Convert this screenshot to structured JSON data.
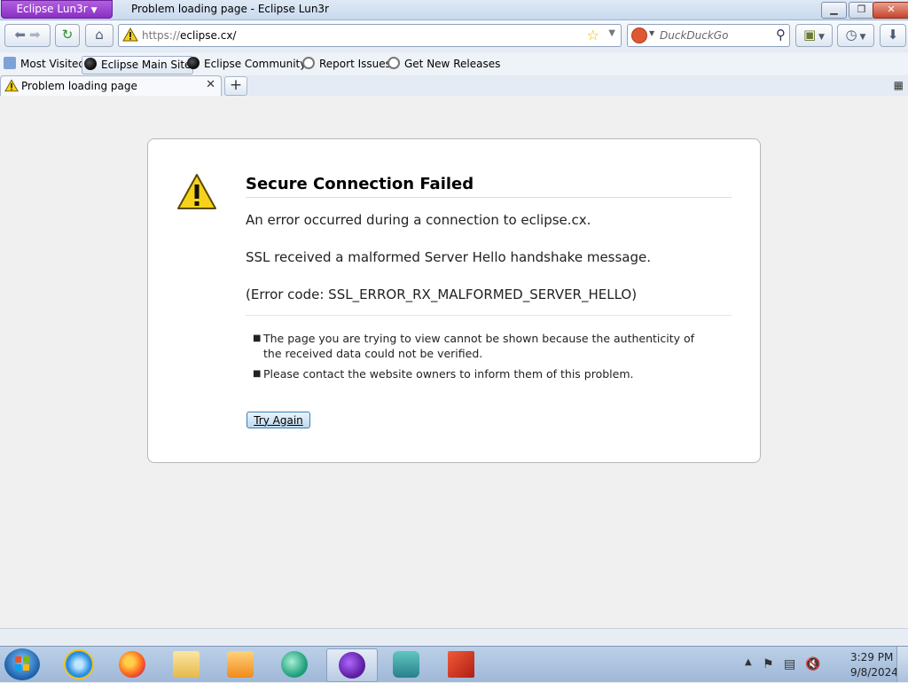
{
  "window": {
    "app_menu_label": "Eclipse Lun3r",
    "title": "Problem loading page - Eclipse Lun3r"
  },
  "navbar": {
    "url_protocol": "https://",
    "url_host": "eclipse.cx/",
    "search_placeholder": "DuckDuckGo"
  },
  "bookmarks": [
    {
      "label": "Most Visited"
    },
    {
      "label": "Eclipse Main Site"
    },
    {
      "label": "Eclipse Community"
    },
    {
      "label": "Report Issues"
    },
    {
      "label": "Get New Releases"
    }
  ],
  "tabs": [
    {
      "label": "Problem loading page"
    }
  ],
  "error": {
    "title": "Secure Connection Failed",
    "line1": "An error occurred during a connection to eclipse.cx.",
    "line2": "SSL received a malformed Server Hello handshake message.",
    "line3": "(Error code: SSL_ERROR_RX_MALFORMED_SERVER_HELLO)",
    "bullet1": "The page you are trying to view cannot be shown because the authenticity of the received data could not be verified.",
    "bullet2": "Please contact the website owners to inform them of this problem.",
    "button": "Try Again"
  },
  "taskbar": {
    "apps": [
      {
        "icon": "internet-explorer-icon"
      },
      {
        "icon": "firefox-icon"
      },
      {
        "icon": "file-explorer-icon"
      },
      {
        "icon": "media-player-icon"
      },
      {
        "icon": "browser-green-icon"
      },
      {
        "icon": "eclipse-lun3r-icon"
      },
      {
        "icon": "wireshark-icon"
      },
      {
        "icon": "red-app-icon"
      }
    ],
    "clock_time": "3:29 PM",
    "clock_date": "9/8/2024"
  },
  "colors": {
    "accent_purple": "#8a2fc4",
    "warning_yellow": "#f7d21c",
    "close_red": "#c8432a"
  }
}
